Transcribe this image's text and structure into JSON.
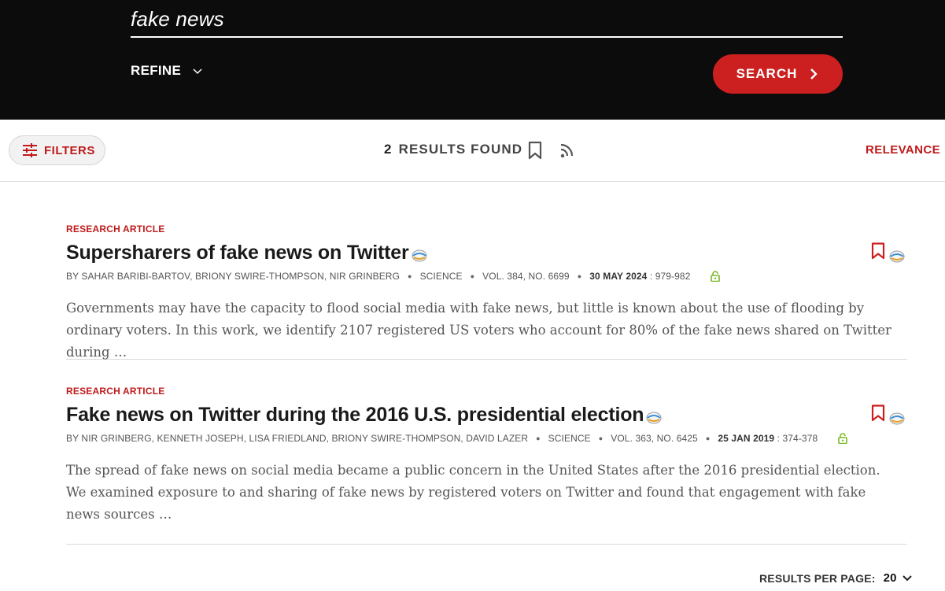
{
  "search": {
    "query": "fake news",
    "refine_label": "REFINE",
    "search_label": "SEARCH"
  },
  "toolbar": {
    "filters_label": "FILTERS",
    "results_count": "2",
    "results_label": "RESULTS FOUND",
    "sort_label": "RELEVANCE",
    "icons": [
      "bookmark-icon",
      "rss-icon"
    ]
  },
  "results": [
    {
      "type": "RESEARCH ARTICLE",
      "title": "Supersharers of fake news on Twitter",
      "authors": [
        "BY SAHAR BARIBI-BARTOV,",
        "BRIONY SWIRE-THOMPSON,",
        "NIR GRINBERG"
      ],
      "journal": "SCIENCE",
      "volume": "VOL. 384, NO. 6699",
      "date": "30 MAY 2024",
      "pages": ": 979-982",
      "abstract": "Governments may have the capacity to flood social media with fake news, but little is known about the use of flooding by ordinary voters. In this work, we identify 2107 registered US voters who account for 80% of the fake news shared on Twitter during …"
    },
    {
      "type": "RESEARCH ARTICLE",
      "title": "Fake news on Twitter during the 2016 U.S. presidential election",
      "authors": [
        "BY NIR GRINBERG,",
        "KENNETH JOSEPH,",
        "LISA FRIEDLAND,",
        "BRIONY SWIRE-THOMPSON,",
        "DAVID LAZER"
      ],
      "journal": "SCIENCE",
      "volume": "VOL. 363, NO. 6425",
      "date": "25 JAN 2019",
      "pages": ": 374-378",
      "abstract": "The spread of fake news on social media became a public concern in the United States after the 2016 presidential election. We examined exposure to and sharing of fake news by registered voters on Twitter and found that engagement with fake news sources …"
    }
  ],
  "pagination": {
    "per_page_label": "RESULTS PER PAGE:",
    "per_page_value": "20"
  },
  "colors": {
    "brand_red": "#cc1f1f",
    "header_bg": "#0c0c0c",
    "lock_green": "#7ab828"
  }
}
